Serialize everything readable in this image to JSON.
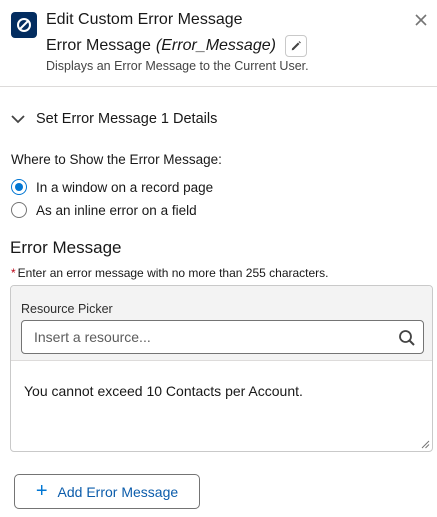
{
  "header": {
    "title": "Edit Custom Error Message",
    "element_label": "Error Message",
    "element_api_name": "(Error_Message)",
    "description": "Displays an Error Message to the Current User.",
    "icon": "error-message-icon"
  },
  "section": {
    "title": "Set Error Message 1 Details",
    "expanded": true
  },
  "location": {
    "label": "Where to Show the Error Message:",
    "options": [
      {
        "label": "In a window on a record page",
        "selected": true
      },
      {
        "label": "As an inline error on a field",
        "selected": false
      }
    ]
  },
  "error_message": {
    "heading": "Error Message",
    "required_marker": "*",
    "help_text": "Enter an error message with no more than 255 characters.",
    "resource_picker_label": "Resource Picker",
    "resource_picker_placeholder": "Insert a resource...",
    "value": "You cannot exceed 10 Contacts per Account."
  },
  "actions": {
    "add_label": "Add Error Message"
  },
  "colors": {
    "brand": "#0176d3",
    "icon_bg": "#032d60",
    "required": "#ba0517"
  }
}
